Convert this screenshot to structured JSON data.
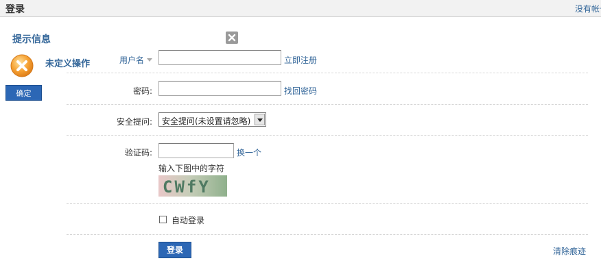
{
  "header": {
    "title": "登录",
    "register_prompt": "没有帐号"
  },
  "notice": {
    "title": "提示信息",
    "message": "未定义操作",
    "confirm_label": "确定"
  },
  "form": {
    "username": {
      "label": "用户名",
      "value": "",
      "link": "立即注册"
    },
    "password": {
      "label": "密码:",
      "value": "",
      "link": "找回密码"
    },
    "question": {
      "label": "安全提问:",
      "selected": "安全提问(未设置请忽略)"
    },
    "captcha": {
      "label": "验证码:",
      "value": "",
      "refresh_link": "换一个",
      "hint": "输入下图中的字符",
      "image_text": "CWfY"
    },
    "auto_login": {
      "label": "自动登录",
      "checked": false
    },
    "submit_label": "登录",
    "clear_link": "清除痕迹"
  }
}
